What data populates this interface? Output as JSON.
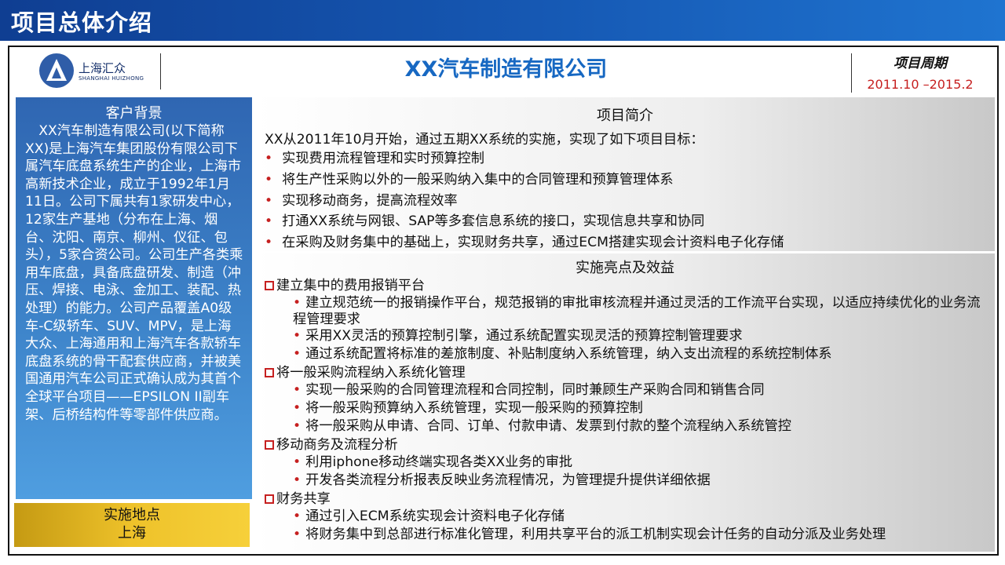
{
  "slide_title": "项目总体介绍",
  "logo": {
    "cn": "上海汇众",
    "en": "SHANGHAI HUIZHONG"
  },
  "company": "XX汽车制造有限公司",
  "period": {
    "label": "项目周期",
    "value": "2011.10 –2015.2"
  },
  "customer": {
    "heading": "客户背景",
    "text": "XX汽车制造有限公司(以下简称XX)是上海汽车集团股份有限公司下属汽车底盘系统生产的企业，上海市高新技术企业，成立于1992年1月11日。公司下属共有1家研发中心，12家生产基地（分布在上海、烟台、沈阳、南京、柳州、仪征、包头），5家合资公司。公司生产各类乘用车底盘，具备底盘研发、制造（冲压、焊接、电泳、金加工、装配、热处理）的能力。公司产品覆盖A0级车-C级轿车、SUV、MPV，是上海大众、上海通用和上海汽车各款轿车底盘系统的骨干配套供应商，并被美国通用汽车公司正式确认成为其首个全球平台项目——EPSILON II副车架、后桥结构件等零部件供应商。"
  },
  "site": {
    "label": "实施地点",
    "value": "上海"
  },
  "intro": {
    "heading": "项目简介",
    "lead": "XX从2011年10月开始，通过五期XX系统的实施，实现了如下项目目标：",
    "bullets": [
      "实现费用流程管理和实时预算控制",
      "将生产性采购以外的一般采购纳入集中的合同管理和预算管理体系",
      "实现移动商务，提高流程效率",
      "打通XX系统与网银、SAP等多套信息系统的接口，实现信息共享和协同",
      "在采购及财务集中的基础上，实现财务共享，通过ECM搭建实现会计资料电子化存储"
    ]
  },
  "highlights": {
    "heading": "实施亮点及效益",
    "groups": [
      {
        "title": "建立集中的费用报销平台",
        "items": [
          "建立规范统一的报销操作平台，规范报销的审批审核流程并通过灵活的工作流平台实现，以适应持续优化的业务流程管理要求",
          "采用XX灵活的预算控制引擎，通过系统配置实现灵活的预算控制管理要求",
          "通过系统配置将标准的差旅制度、补贴制度纳入系统管理，纳入支出流程的系统控制体系"
        ]
      },
      {
        "title": "将一般采购流程纳入系统化管理",
        "items": [
          "实现一般采购的合同管理流程和合同控制，同时兼顾生产采购合同和销售合同",
          "将一般采购预算纳入系统管理，实现一般采购的预算控制",
          "将一般采购从申请、合同、订单、付款申请、发票到付款的整个流程纳入系统管控"
        ]
      },
      {
        "title": "移动商务及流程分析",
        "items": [
          "利用iphone移动终端实现各类XX业务的审批",
          "开发各类流程分析报表反映业务流程情况，为管理提升提供详细依据"
        ]
      },
      {
        "title": "财务共享",
        "items": [
          "通过引入ECM系统实现会计资料电子化存储",
          "将财务集中到总部进行标准化管理，利用共享平台的派工机制实现会计任务的自动分派及业务处理"
        ]
      }
    ]
  },
  "colors": {
    "title_bar": "#1659b4",
    "company": "#1768c2",
    "bullet": "#c62020",
    "site_panel": "#eec22a"
  }
}
